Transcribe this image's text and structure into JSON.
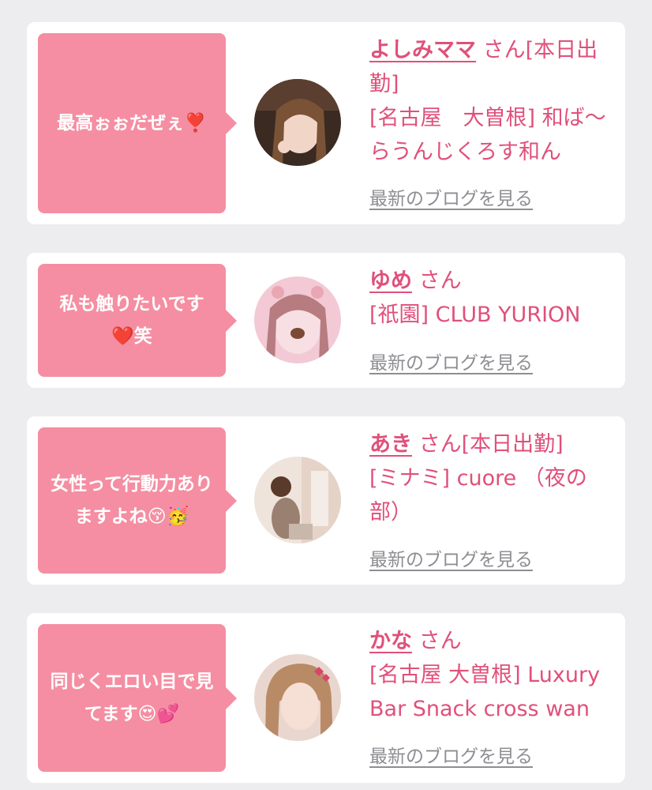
{
  "entries": [
    {
      "comment": "最高ぉぉだぜぇ❣️",
      "name": "よしみママ",
      "suffix": "さん[本日出勤]",
      "shop": "[名古屋　大曽根] 和ば〜らうんじくろす和ん",
      "link": "最新のブログを見る",
      "avatar_icon": "profile-photo-icon"
    },
    {
      "comment": "私も触りたいです\n❤️笑",
      "name": "ゆめ",
      "suffix": "さん",
      "shop": "[祇園] CLUB YURION",
      "link": "最新のブログを見る",
      "avatar_icon": "profile-photo-icon"
    },
    {
      "comment": "女性って行動力ありますよね😚🥳",
      "name": "あき",
      "suffix": "さん[本日出勤]",
      "shop": "[ミナミ] cuore （夜の部）",
      "link": "最新のブログを見る",
      "avatar_icon": "profile-photo-icon"
    },
    {
      "comment": "同じくエロい目で見てます😍💕",
      "name": "かな",
      "suffix": "さん",
      "shop": "[名古屋 大曽根] Luxury Bar Snack cross wan",
      "link": "最新のブログを見る",
      "avatar_icon": "profile-photo-icon"
    }
  ],
  "colors": {
    "bubble": "#f58ea2",
    "accent_text": "#e0507a",
    "link_gray": "#8e8e93",
    "background": "#ededf0"
  }
}
